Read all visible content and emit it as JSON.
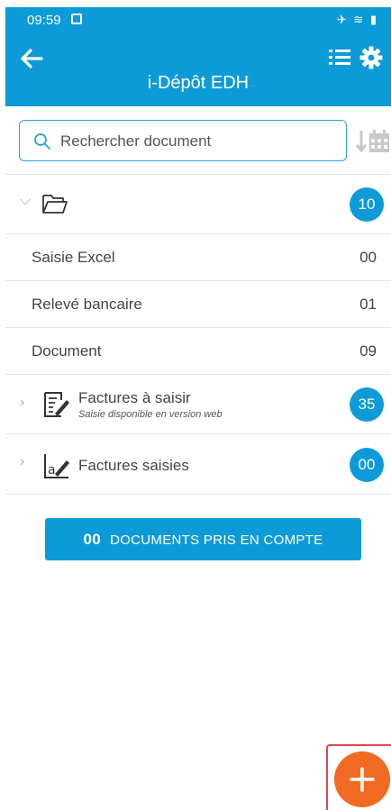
{
  "status_bar": {
    "time": "09:59",
    "icons": "✈ ≋ ▮"
  },
  "header": {
    "title": "i-Dépôt EDH"
  },
  "search": {
    "placeholder": "Rechercher document"
  },
  "folder_group": {
    "count": "10"
  },
  "items": [
    {
      "label": "Saisie Excel",
      "value": "00"
    },
    {
      "label": "Relevé bancaire",
      "value": "01"
    },
    {
      "label": "Document",
      "value": "09"
    }
  ],
  "factures_a_saisir": {
    "title": "Factures à saisir",
    "subtitle": "Saisie disponible en version web",
    "count": "35"
  },
  "factures_saisies": {
    "title": "Factures saisies",
    "count": "00"
  },
  "cta": {
    "count": "00",
    "label": "DOCUMENTS PRIS EN COMPTE"
  },
  "colors": {
    "primary": "#0c9bd8",
    "fab": "#f26a22"
  }
}
